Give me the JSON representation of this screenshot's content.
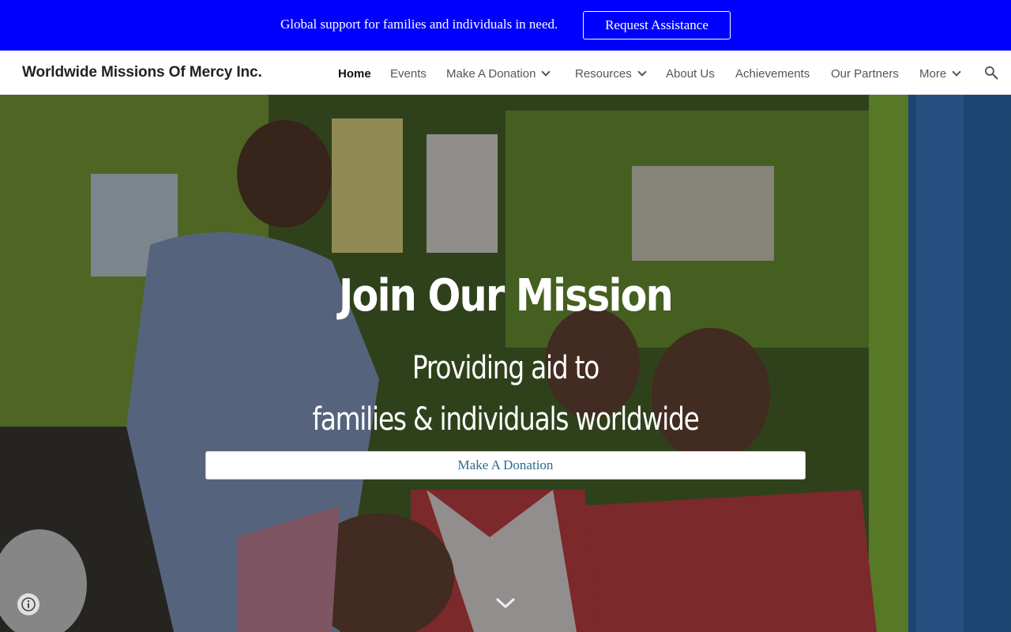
{
  "banner": {
    "text": "Global support for families and individuals in need.",
    "button_label": "Request Assistance",
    "background": "#0000ff"
  },
  "header": {
    "site_title": "Worldwide Missions Of Mercy Inc.",
    "nav": [
      {
        "label": "Home",
        "active": true,
        "dropdown": false
      },
      {
        "label": "Events",
        "active": false,
        "dropdown": false
      },
      {
        "label": "Make A Donation",
        "active": false,
        "dropdown": true
      },
      {
        "label": "Resources",
        "active": false,
        "dropdown": true
      },
      {
        "label": "About Us",
        "active": false,
        "dropdown": false
      },
      {
        "label": "Achievements",
        "active": false,
        "dropdown": false
      },
      {
        "label": "Our Partners",
        "active": false,
        "dropdown": false
      },
      {
        "label": "More",
        "active": false,
        "dropdown": true
      }
    ],
    "search_icon": "search-icon"
  },
  "hero": {
    "title": "Join Our Mission",
    "subtitle_line1": "Providing aid to",
    "subtitle_line2": "families & individuals worldwide",
    "button_label": "Make A Donation",
    "button_text_color": "#2d6a96",
    "scroll_icon": "chevron-down-icon",
    "info_icon": "info-icon"
  }
}
